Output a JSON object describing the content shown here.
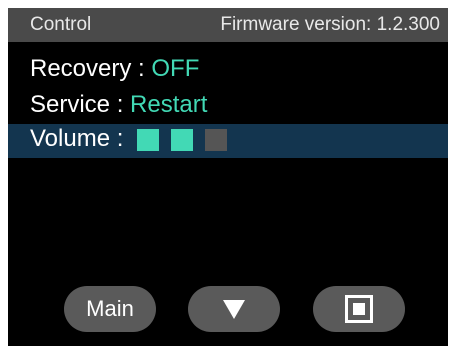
{
  "header": {
    "title": "Control",
    "firmware": "Firmware version: 1.2.300"
  },
  "menu": {
    "items": [
      {
        "label": "Recovery : ",
        "value": "OFF"
      },
      {
        "label": "Service : ",
        "value": "Restart"
      },
      {
        "label": "Volume : ",
        "value": null,
        "level": 2,
        "max_level": 3
      }
    ],
    "selected_index": 2
  },
  "softkeys": {
    "main_label": "Main",
    "down_icon": "triangle-down-icon",
    "select_icon": "square-select-icon"
  },
  "colors": {
    "accent": "#42d9b5",
    "header_bg": "#4a4a4a",
    "selected_row_bg": "#13354f",
    "inactive_level": "#555555",
    "softkey_bg": "#5a5a5a"
  }
}
